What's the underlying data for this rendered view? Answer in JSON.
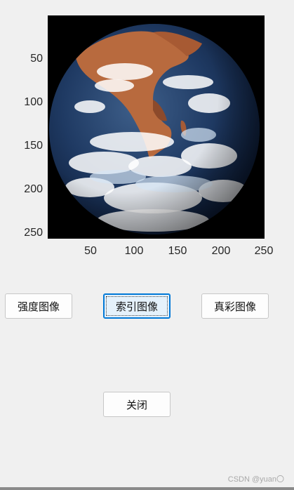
{
  "axes": {
    "y_ticks": [
      "50",
      "100",
      "150",
      "200",
      "250"
    ],
    "x_ticks": [
      "50",
      "100",
      "150",
      "200",
      "250"
    ]
  },
  "image": {
    "subject": "earth-globe"
  },
  "buttons": {
    "intensity_label": "强度图像",
    "indexed_label": "索引图像",
    "truecolor_label": "真彩图像",
    "close_label": "关闭"
  },
  "watermark": "CSDN @yuan〇"
}
